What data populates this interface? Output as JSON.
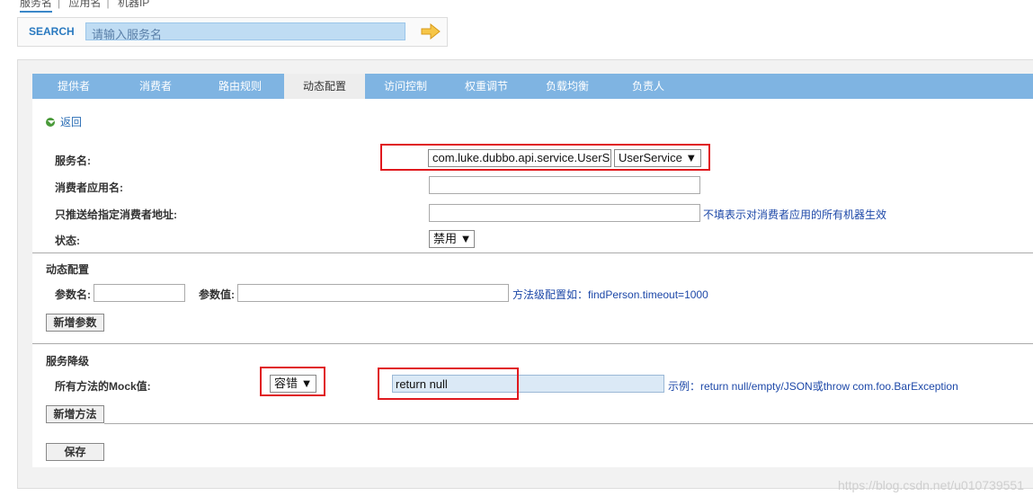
{
  "top_tabs": [
    "服务名",
    "应用名",
    "机器IP"
  ],
  "search": {
    "label": "SEARCH",
    "placeholder": "请输入服务名"
  },
  "tabs": [
    {
      "label": "提供者"
    },
    {
      "label": "消费者"
    },
    {
      "label": "路由规则"
    },
    {
      "label": "动态配置"
    },
    {
      "label": "访问控制"
    },
    {
      "label": "权重调节"
    },
    {
      "label": "负载均衡"
    },
    {
      "label": "负责人"
    }
  ],
  "back_label": "返回",
  "form": {
    "service_label": "服务名:",
    "service_value": "com.luke.dubbo.api.service.UserS",
    "service_select": "UserService",
    "consumer_app_label": "消费者应用名:",
    "consumer_app_value": "",
    "push_addr_label": "只推送给指定消费者地址:",
    "push_addr_value": "",
    "push_addr_hint": "不填表示对消费者应用的所有机器生效",
    "status_label": "状态:",
    "status_value": "禁用"
  },
  "dynamic": {
    "title": "动态配置",
    "param_name_label": "参数名:",
    "param_value_label": "参数值:",
    "hint": "方法级配置如：findPerson.timeout=1000",
    "add_button": "新增参数"
  },
  "degrade": {
    "title": "服务降级",
    "mock_label": "所有方法的Mock值:",
    "mock_select": "容错",
    "mock_value": "return null",
    "hint": "示例：return null/empty/JSON或throw com.foo.BarException",
    "add_button": "新增方法"
  },
  "save_button": "保存",
  "watermark": "https://blog.csdn.net/u010739551",
  "colors": {
    "tab_bar": "#7fb4e2",
    "highlight": "#e0191e",
    "link": "#1d48a8"
  }
}
